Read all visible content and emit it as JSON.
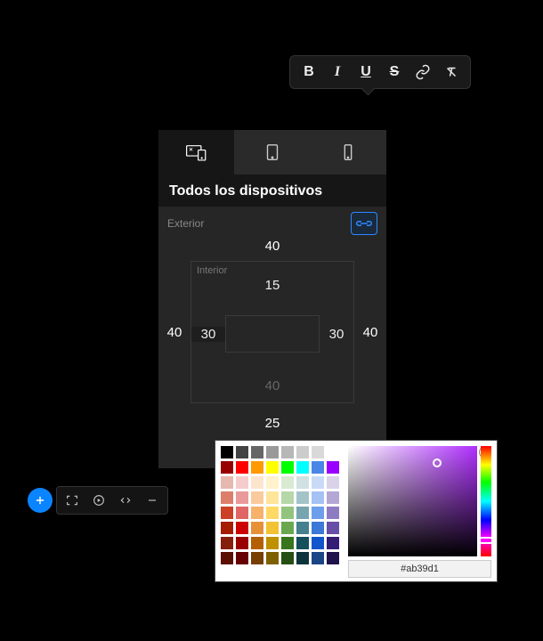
{
  "toolbar": {
    "buttons": [
      "bold",
      "italic",
      "underline",
      "strikethrough",
      "link",
      "clear-format"
    ]
  },
  "panel": {
    "title": "Todos los dispositivos",
    "outer_label": "Exterior",
    "inner_label": "Interior",
    "outer": {
      "top": "40",
      "right": "40",
      "bottom": "25",
      "left": "40"
    },
    "inner": {
      "top": "15",
      "right": "30",
      "bottom": "40",
      "left": "30"
    }
  },
  "picker": {
    "hex": "#ab39d1",
    "swatches": [
      "#000000",
      "#434343",
      "#666666",
      "#999999",
      "#b7b7b7",
      "#cccccc",
      "#d9d9d9",
      "#ffffff",
      "#980000",
      "#ff0000",
      "#ff9900",
      "#ffff00",
      "#00ff00",
      "#00ffff",
      "#4a86e8",
      "#9900ff",
      "#e6b8af",
      "#f4cccc",
      "#fce5cd",
      "#fff2cc",
      "#d9ead3",
      "#d0e0e3",
      "#c9daf8",
      "#d9d2e9",
      "#dd7e6b",
      "#ea9999",
      "#f9cb9c",
      "#ffe599",
      "#b6d7a8",
      "#a2c4c9",
      "#a4c2f4",
      "#b4a7d6",
      "#cc4125",
      "#e06666",
      "#f6b26b",
      "#ffd966",
      "#93c47d",
      "#76a5af",
      "#6d9eeb",
      "#8e7cc3",
      "#a61c00",
      "#cc0000",
      "#e69138",
      "#f1c232",
      "#6aa84f",
      "#45818e",
      "#3c78d8",
      "#674ea7",
      "#85200c",
      "#990000",
      "#b45f06",
      "#bf9000",
      "#38761d",
      "#134f5c",
      "#1155cc",
      "#351c75",
      "#5b0f00",
      "#660000",
      "#783f04",
      "#7f6000",
      "#274e13",
      "#0c343d",
      "#1c4587",
      "#20124d"
    ]
  }
}
